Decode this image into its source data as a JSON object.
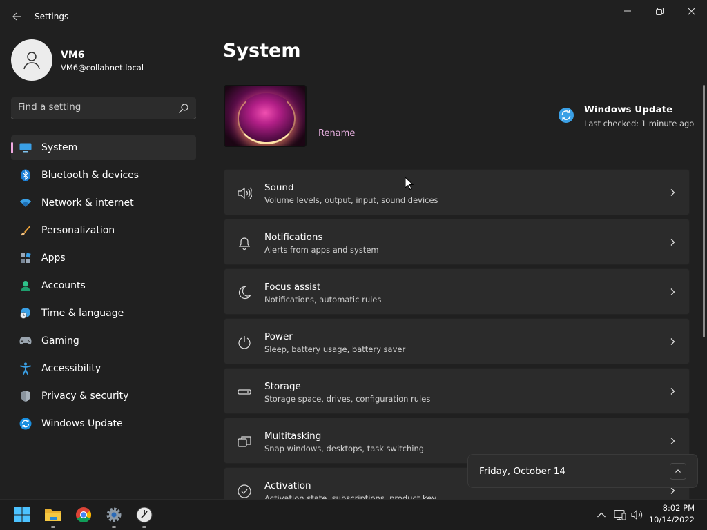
{
  "window": {
    "title": "Settings"
  },
  "user": {
    "name": "VM6",
    "email": "VM6@collabnet.local"
  },
  "search": {
    "placeholder": "Find a setting"
  },
  "sidebar": {
    "items": [
      {
        "label": "System",
        "icon": "system-icon",
        "active": true
      },
      {
        "label": "Bluetooth & devices",
        "icon": "bluetooth-icon"
      },
      {
        "label": "Network & internet",
        "icon": "wifi-icon"
      },
      {
        "label": "Personalization",
        "icon": "brush-icon"
      },
      {
        "label": "Apps",
        "icon": "apps-icon"
      },
      {
        "label": "Accounts",
        "icon": "accounts-icon"
      },
      {
        "label": "Time & language",
        "icon": "globe-clock-icon"
      },
      {
        "label": "Gaming",
        "icon": "gamepad-icon"
      },
      {
        "label": "Accessibility",
        "icon": "accessibility-icon"
      },
      {
        "label": "Privacy & security",
        "icon": "shield-icon"
      },
      {
        "label": "Windows Update",
        "icon": "update-icon"
      }
    ]
  },
  "main": {
    "title": "System",
    "rename_label": "Rename",
    "windows_update": {
      "title": "Windows Update",
      "subtitle": "Last checked: 1 minute ago"
    },
    "cards": [
      {
        "title": "Sound",
        "subtitle": "Volume levels, output, input, sound devices",
        "icon": "speaker-icon"
      },
      {
        "title": "Notifications",
        "subtitle": "Alerts from apps and system",
        "icon": "bell-icon"
      },
      {
        "title": "Focus assist",
        "subtitle": "Notifications, automatic rules",
        "icon": "moon-icon"
      },
      {
        "title": "Power",
        "subtitle": "Sleep, battery usage, battery saver",
        "icon": "power-icon"
      },
      {
        "title": "Storage",
        "subtitle": "Storage space, drives, configuration rules",
        "icon": "storage-icon"
      },
      {
        "title": "Multitasking",
        "subtitle": "Snap windows, desktops, task switching",
        "icon": "multitask-icon"
      },
      {
        "title": "Activation",
        "subtitle": "Activation state, subscriptions, product key",
        "icon": "check-circle-icon"
      }
    ]
  },
  "flyout": {
    "date": "Friday, October 14"
  },
  "taskbar": {
    "apps": [
      "start-icon",
      "file-explorer-icon",
      "chrome-icon",
      "settings-icon",
      "clock-app-icon"
    ],
    "time": "8:02 PM",
    "date": "10/14/2022"
  },
  "colors": {
    "accent": "#f0a8e0",
    "background": "#202020",
    "card": "#2b2b2b",
    "update_blue": "#4cc2ff"
  }
}
